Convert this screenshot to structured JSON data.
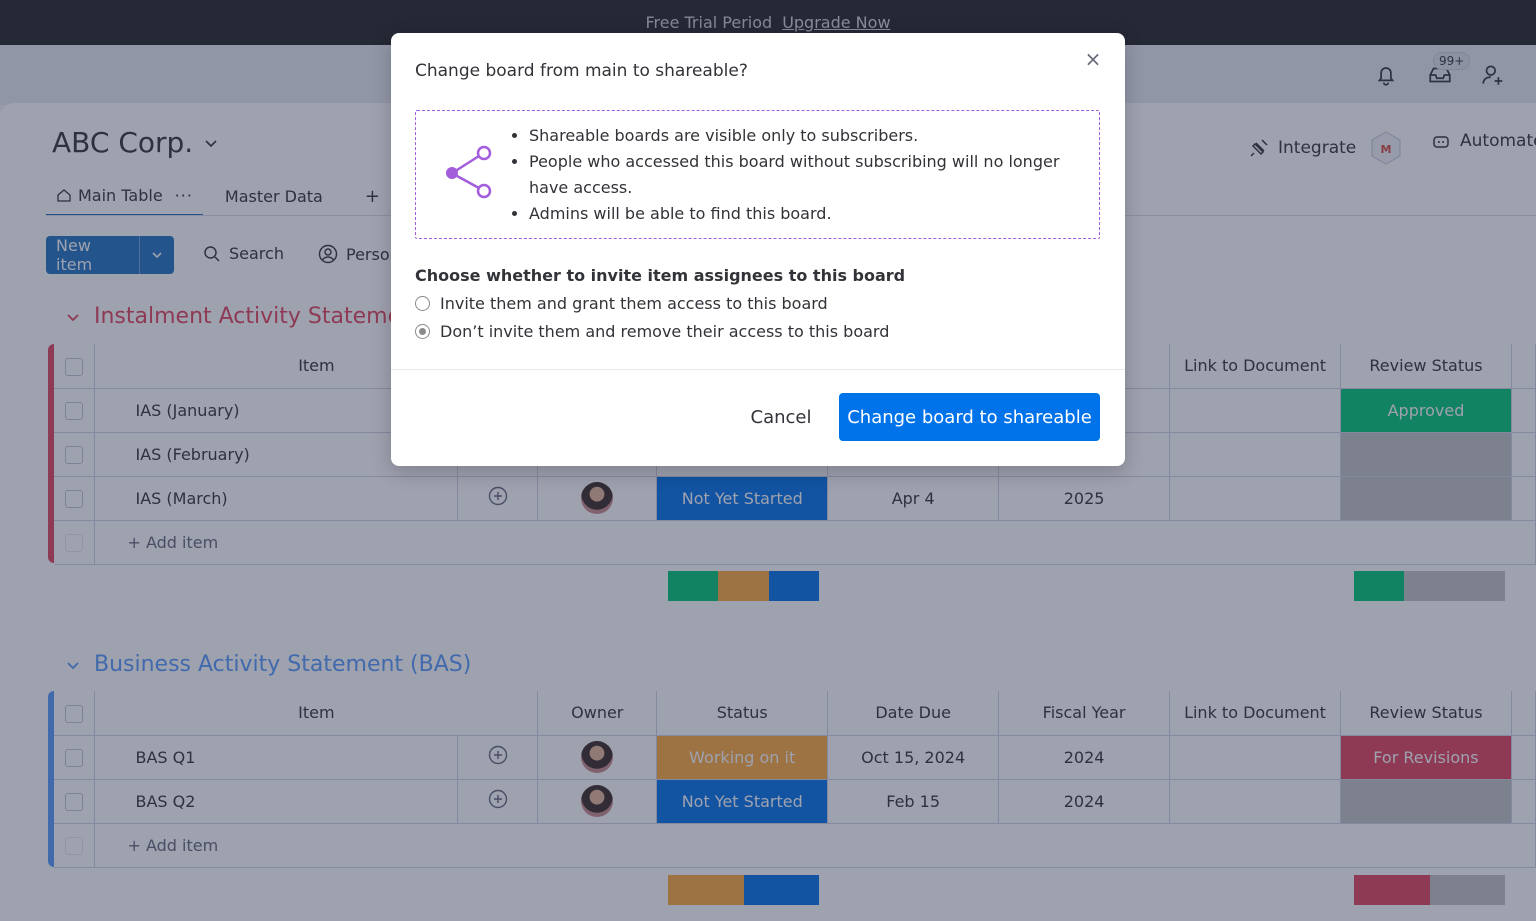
{
  "topbar": {
    "trial_text": "Free Trial Period",
    "upgrade_link": "Upgrade Now"
  },
  "appbar": {
    "notifications_icon": "bell-icon",
    "inbox_icon": "inbox-icon",
    "inbox_badge": "99+",
    "invite_icon": "add-user-icon"
  },
  "board": {
    "title": "ABC Corp.",
    "tabs": [
      {
        "label": "Main Table",
        "icon": "home-icon"
      },
      {
        "label": "Master Data"
      }
    ],
    "add_tab": "+",
    "integrate_label": "Integrate",
    "automate_label": "Automate",
    "new_item_label": "New item",
    "search_label": "Search",
    "person_label": "Perso"
  },
  "groups": [
    {
      "title": "Instalment Activity Stateme",
      "color": "#e2445c",
      "columns": [
        "Item",
        "",
        "Owner",
        "Status",
        "Date Due",
        "Fiscal Year",
        "Link to Document",
        "Review Status"
      ],
      "rows": [
        {
          "item": "IAS (January)",
          "status": "",
          "status_color": "#00c875",
          "date": "",
          "year": "",
          "review": "Approved",
          "review_color": "#00c875"
        },
        {
          "item": "IAS (February)",
          "status": "",
          "status_color": "#fdab3d",
          "date": "",
          "year": "",
          "review": "",
          "review_color": "#c4c4c4"
        },
        {
          "item": "IAS (March)",
          "status": "Not Yet Started",
          "status_color": "#0073ea",
          "date": "Apr 4",
          "year": "2025",
          "review": "",
          "review_color": "#c4c4c4"
        }
      ],
      "add_item": "+ Add item"
    },
    {
      "title": "Business Activity Statement (BAS)",
      "color": "#579bfc",
      "columns": [
        "Item",
        "",
        "Owner",
        "Status",
        "Date Due",
        "Fiscal Year",
        "Link to Document",
        "Review Status"
      ],
      "rows": [
        {
          "item": "BAS Q1",
          "status": "Working on it",
          "status_color": "#fdab3d",
          "date": "Oct 15, 2024",
          "year": "2024",
          "review": "For Revisions",
          "review_color": "#e2445c"
        },
        {
          "item": "BAS Q2",
          "status": "Not Yet Started",
          "status_color": "#0073ea",
          "date": "Feb 15",
          "year": "2024",
          "review": "",
          "review_color": "#c4c4c4"
        }
      ],
      "add_item": "+ Add item"
    }
  ],
  "modal": {
    "title": "Change board from main to shareable?",
    "close_icon": "close-icon",
    "info_icon": "share-icon",
    "bullets": [
      "Shareable boards are visible only to subscribers.",
      "People who accessed this board without subscribing will no longer have access.",
      "Admins will be able to find this board."
    ],
    "question": "Choose whether to invite item assignees to this board",
    "options": [
      {
        "label": "Invite them and grant them access to this board",
        "selected": false
      },
      {
        "label": "Don’t invite them and remove their access to this board",
        "selected": true
      }
    ],
    "cancel_label": "Cancel",
    "confirm_label": "Change board to shareable"
  },
  "colors": {
    "primary": "#0073ea",
    "accent_purple": "#a25ddc",
    "done": "#00c875",
    "working": "#fdab3d",
    "stuck": "#e2445c",
    "empty": "#c4c4c4"
  }
}
